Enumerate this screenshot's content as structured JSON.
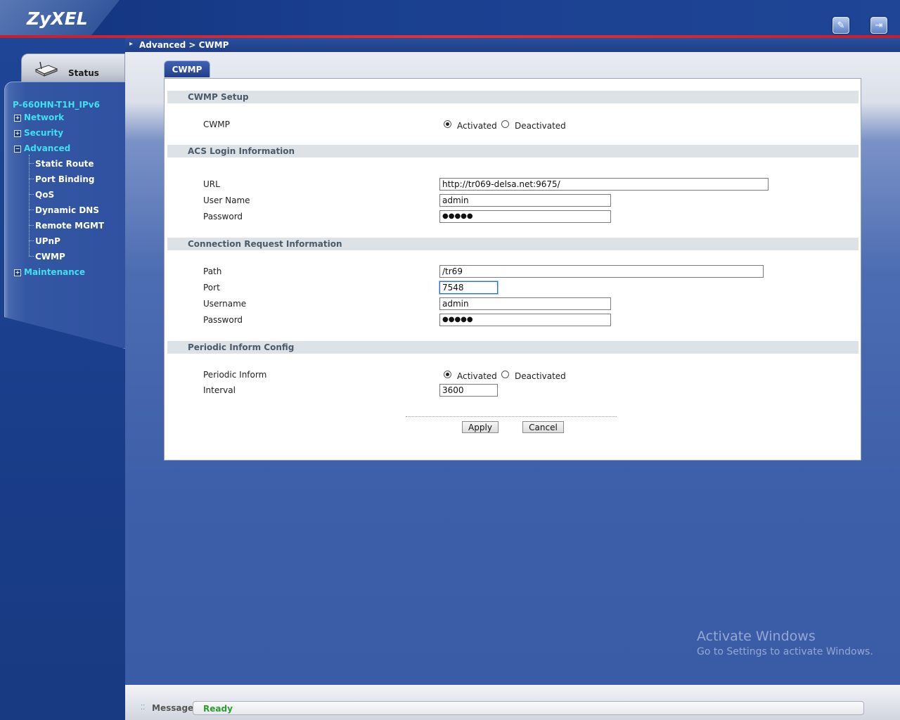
{
  "header": {
    "brand": "ZyXEL",
    "icons": [
      "wizard-icon",
      "logout-icon"
    ]
  },
  "breadcrumb": "Advanced > CWMP",
  "sidebar": {
    "status_tab": "Status",
    "device_name": "P-660HN-T1H_IPv6",
    "nav": [
      {
        "label": "Network",
        "expanded": false
      },
      {
        "label": "Security",
        "expanded": false
      },
      {
        "label": "Advanced",
        "expanded": true,
        "children": [
          "Static Route",
          "Port Binding",
          "QoS",
          "Dynamic DNS",
          "Remote MGMT",
          "UPnP",
          "CWMP"
        ]
      },
      {
        "label": "Maintenance",
        "expanded": false
      }
    ]
  },
  "tab": "CWMP",
  "sections": {
    "setup": {
      "title": "CWMP Setup",
      "cwmp_label": "CWMP",
      "activated": "Activated",
      "deactivated": "Deactivated",
      "selected": "Activated"
    },
    "acs": {
      "title": "ACS Login Information",
      "url_label": "URL",
      "url_value": "http://tr069-delsa.net:9675/",
      "username_label": "User Name",
      "username_value": "admin",
      "password_label": "Password",
      "password_value": "●●●●●"
    },
    "conn": {
      "title": "Connection Request Information",
      "path_label": "Path",
      "path_value": "/tr69",
      "port_label": "Port",
      "port_value": "7548",
      "username_label": "Username",
      "username_value": "admin",
      "password_label": "Password",
      "password_value": "●●●●●"
    },
    "periodic": {
      "title": "Periodic Inform Config",
      "inform_label": "Periodic Inform",
      "activated": "Activated",
      "deactivated": "Deactivated",
      "selected": "Activated",
      "interval_label": "Interval",
      "interval_value": "3600"
    }
  },
  "buttons": {
    "apply": "Apply",
    "cancel": "Cancel"
  },
  "watermark": {
    "line1": "Activate Windows",
    "line2": "Go to Settings to activate Windows."
  },
  "statusbar": {
    "label": "Message",
    "text": "Ready"
  }
}
